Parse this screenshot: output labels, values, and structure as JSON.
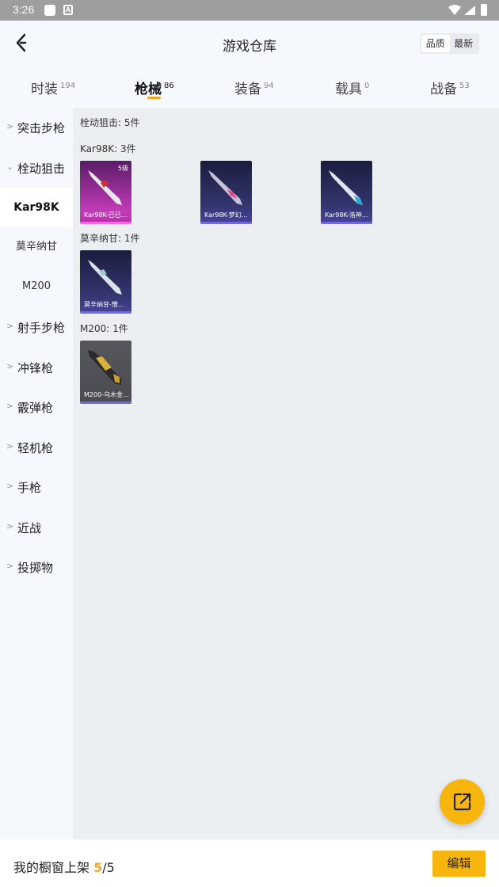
{
  "status_bar": {
    "time": "3:26"
  },
  "header": {
    "title": "游戏仓库",
    "sort_quality": "品质",
    "sort_newest": "最新"
  },
  "tabs": [
    {
      "label": "时装",
      "count": "194"
    },
    {
      "label": "枪械",
      "count": "86"
    },
    {
      "label": "装备",
      "count": "94"
    },
    {
      "label": "载具",
      "count": "0"
    },
    {
      "label": "战备",
      "count": "53"
    }
  ],
  "sidebar": {
    "categories": [
      {
        "label": "突击步枪"
      },
      {
        "label": "栓动狙击"
      },
      {
        "label": "射手步枪"
      },
      {
        "label": "冲锋枪"
      },
      {
        "label": "霰弹枪"
      },
      {
        "label": "轻机枪"
      },
      {
        "label": "手枪"
      },
      {
        "label": "近战"
      },
      {
        "label": "投掷物"
      }
    ],
    "subitems": [
      {
        "label": "Kar98K"
      },
      {
        "label": "莫辛纳甘"
      },
      {
        "label": "M200"
      }
    ]
  },
  "content": {
    "section_title": "栓动狙击: 5件",
    "groups": [
      {
        "title": "Kar98K: 3件",
        "items": [
          {
            "name": "Kar98K-已已...",
            "level": "5级"
          },
          {
            "name": "Kar98K-梦幻..."
          },
          {
            "name": "Kar98K-洛神..."
          }
        ]
      },
      {
        "title": "莫辛纳甘: 1件",
        "items": [
          {
            "name": "莫辛纳甘-憎..."
          }
        ]
      },
      {
        "title": "M200: 1件",
        "items": [
          {
            "name": "M200-乌木金..."
          }
        ]
      }
    ]
  },
  "bottom_bar": {
    "label": "我的橱窗上架",
    "count": "5",
    "total": "/5",
    "edit": "编辑"
  },
  "colors": {
    "accent": "#f8b50e",
    "tab_indicator": "#f5a623"
  }
}
